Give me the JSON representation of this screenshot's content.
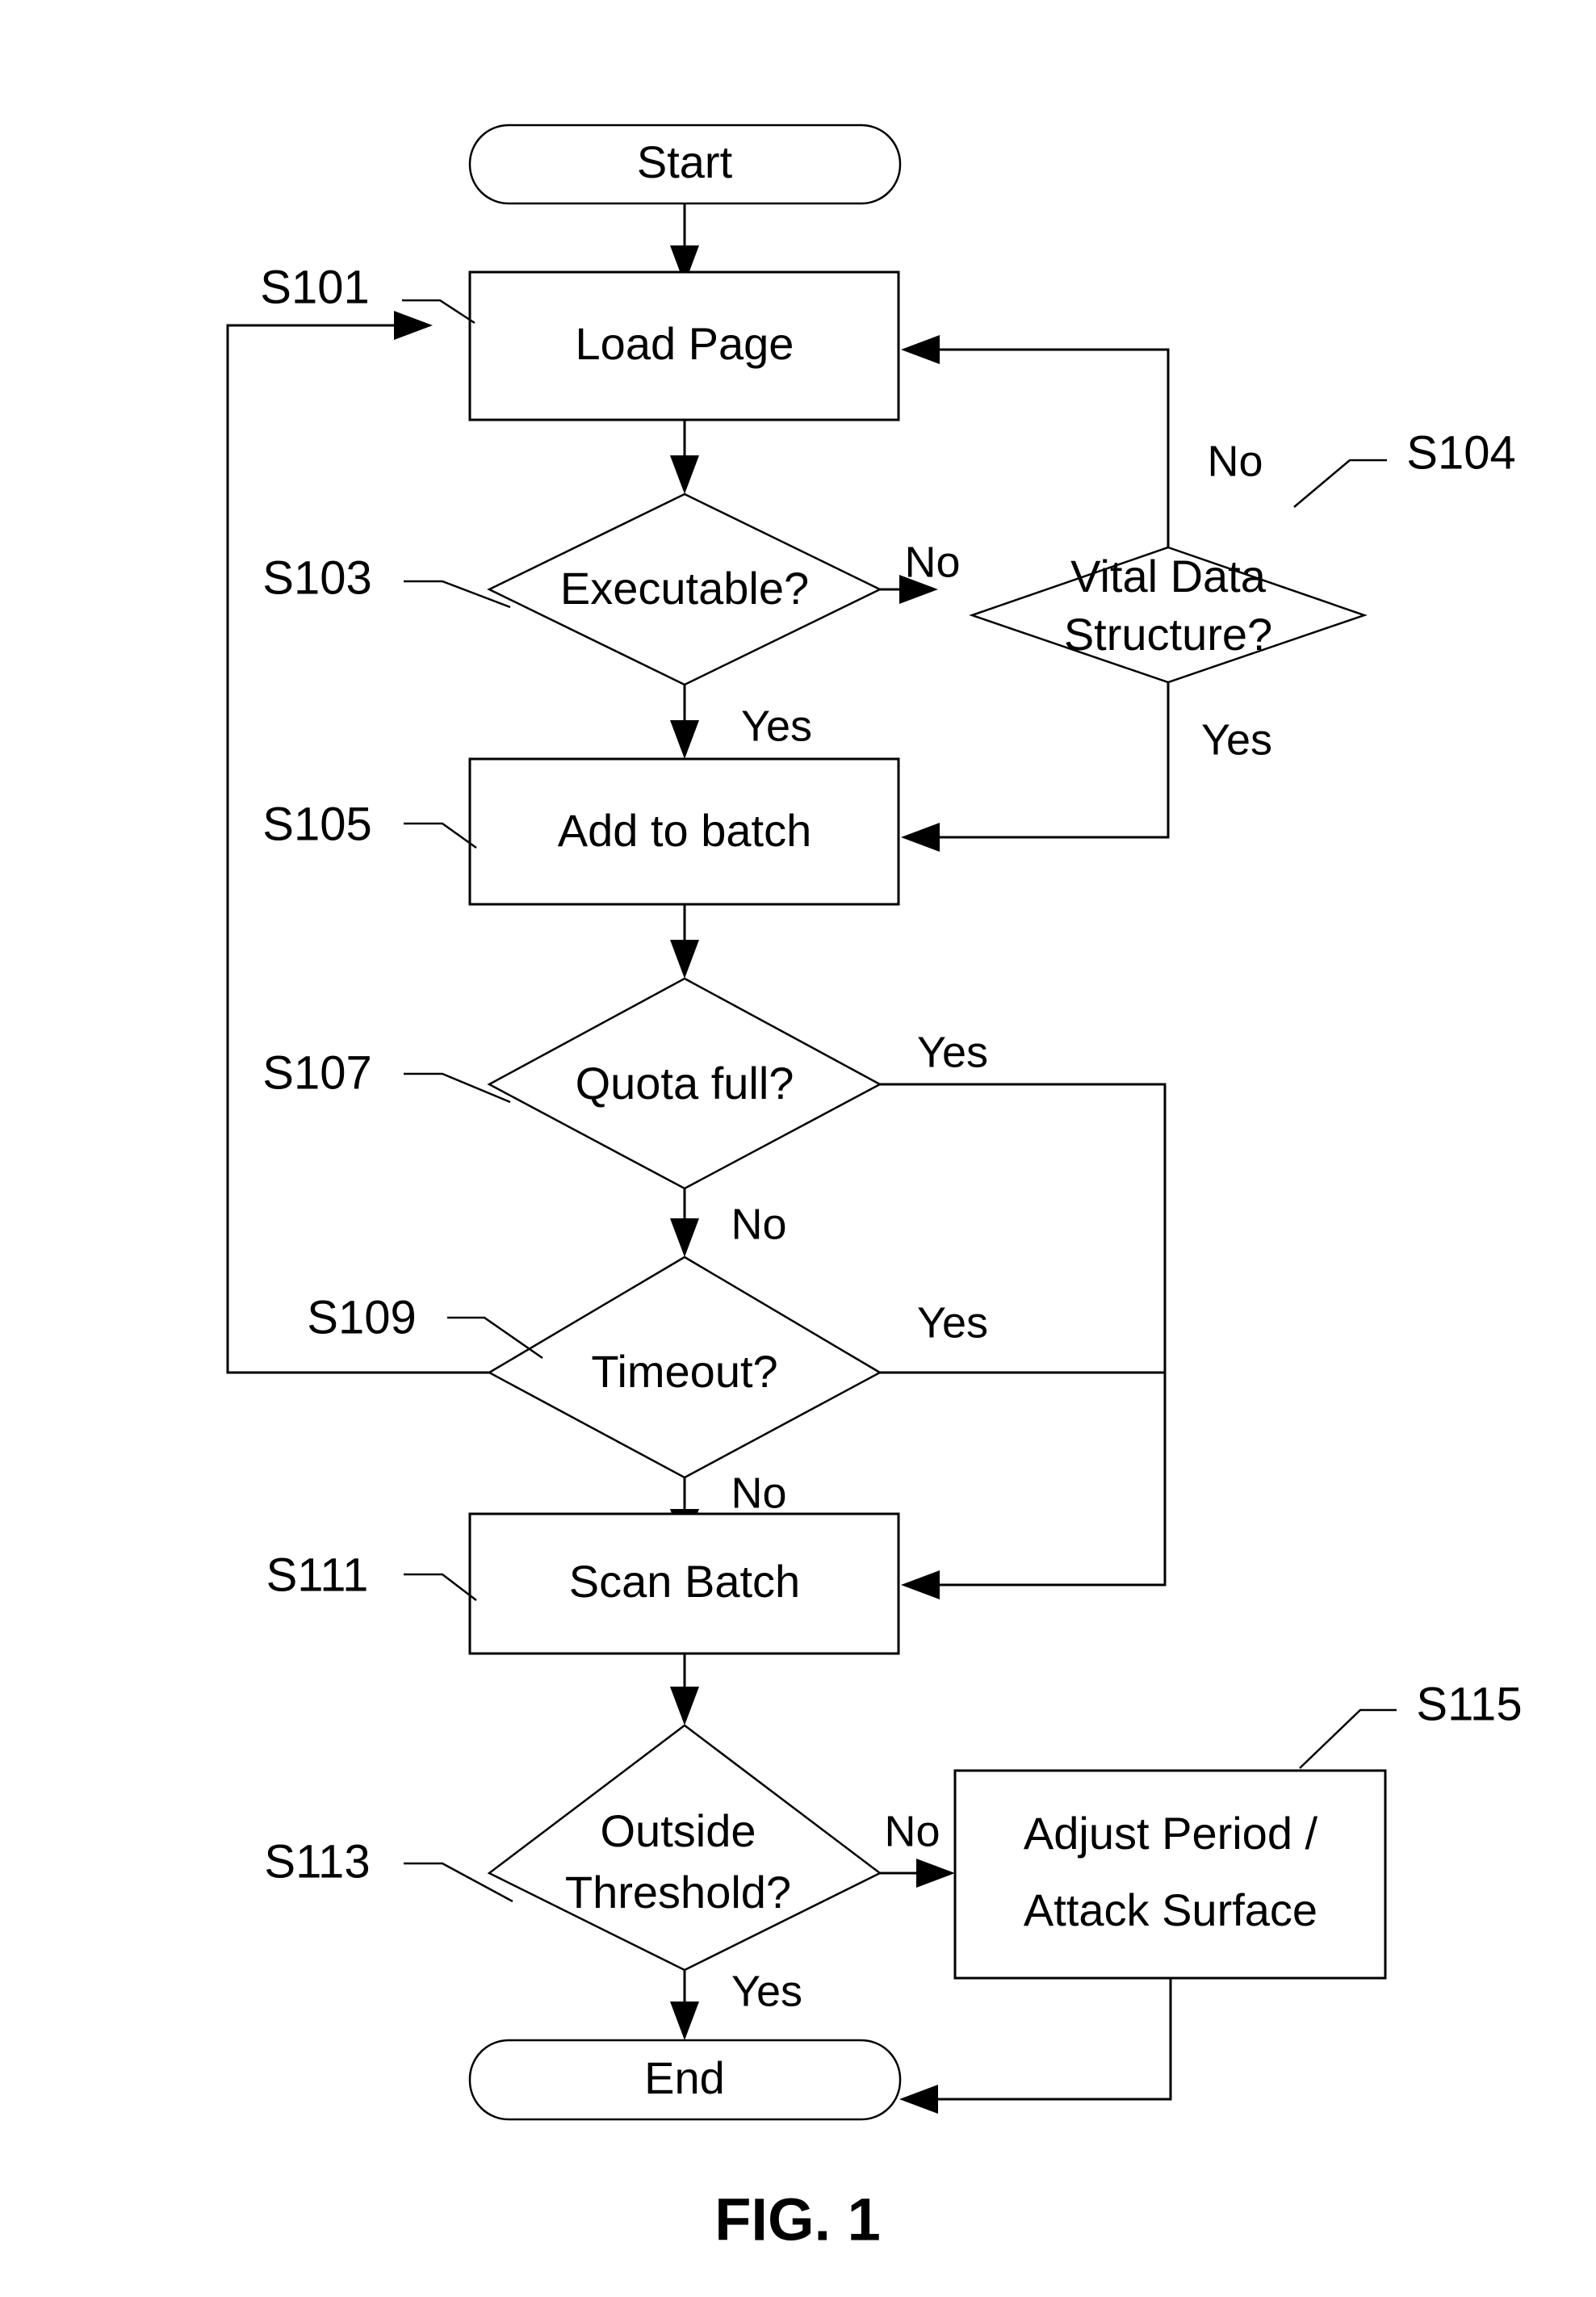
{
  "figure": {
    "caption": "FIG. 1",
    "type": "patent-flowchart"
  },
  "nodes": {
    "start": {
      "label": "Start",
      "shape": "terminator"
    },
    "load_page": {
      "label": "Load Page",
      "shape": "process",
      "step": "S101"
    },
    "executable": {
      "label": "Executable?",
      "shape": "decision",
      "step": "S103"
    },
    "vital_data_l1": {
      "label": "Vital Data",
      "label2": "Structure?",
      "shape": "decision",
      "step": "S104"
    },
    "add_to_batch": {
      "label": "Add to batch",
      "shape": "process",
      "step": "S105"
    },
    "quota_full": {
      "label": "Quota full?",
      "shape": "decision",
      "step": "S107"
    },
    "timeout": {
      "label": "Timeout?",
      "shape": "decision",
      "step": "S109"
    },
    "scan_batch": {
      "label": "Scan Batch",
      "shape": "process",
      "step": "S111"
    },
    "outside_threshold_l1": {
      "label": "Outside",
      "label2": "Threshold?",
      "shape": "decision",
      "step": "S113"
    },
    "adjust_period_l1": {
      "label": "Adjust Period /",
      "label2": "Attack Surface",
      "shape": "process",
      "step": "S115"
    },
    "end": {
      "label": "End",
      "shape": "terminator"
    }
  },
  "step_labels": {
    "s101": "S101",
    "s103": "S103",
    "s104": "S104",
    "s105": "S105",
    "s107": "S107",
    "s109": "S109",
    "s111": "S111",
    "s113": "S113",
    "s115": "S115"
  },
  "edge_labels": {
    "executable_no": "No",
    "executable_yes": "Yes",
    "vital_no": "No",
    "vital_yes": "Yes",
    "quota_yes": "Yes",
    "quota_no": "No",
    "timeout_yes": "Yes",
    "timeout_no": "No",
    "threshold_no": "No",
    "threshold_yes": "Yes"
  },
  "colors": {
    "stroke": "#000000",
    "fill": "#ffffff",
    "background": "#ffffff"
  },
  "chart_data": {
    "type": "flowchart",
    "title": "FIG. 1",
    "nodes": [
      {
        "id": "S_start",
        "label": "Start",
        "shape": "terminator"
      },
      {
        "id": "S101",
        "label": "Load Page",
        "shape": "process"
      },
      {
        "id": "S103",
        "label": "Executable?",
        "shape": "decision"
      },
      {
        "id": "S104",
        "label": "Vital Data Structure?",
        "shape": "decision"
      },
      {
        "id": "S105",
        "label": "Add to batch",
        "shape": "process"
      },
      {
        "id": "S107",
        "label": "Quota full?",
        "shape": "decision"
      },
      {
        "id": "S109",
        "label": "Timeout?",
        "shape": "decision"
      },
      {
        "id": "S111",
        "label": "Scan Batch",
        "shape": "process"
      },
      {
        "id": "S113",
        "label": "Outside Threshold?",
        "shape": "decision"
      },
      {
        "id": "S115",
        "label": "Adjust Period / Attack Surface",
        "shape": "process"
      },
      {
        "id": "S_end",
        "label": "End",
        "shape": "terminator"
      }
    ],
    "edges": [
      {
        "from": "S_start",
        "to": "S101",
        "label": ""
      },
      {
        "from": "S101",
        "to": "S103",
        "label": ""
      },
      {
        "from": "S103",
        "to": "S104",
        "label": "No"
      },
      {
        "from": "S103",
        "to": "S105",
        "label": "Yes"
      },
      {
        "from": "S104",
        "to": "S101",
        "label": "No"
      },
      {
        "from": "S104",
        "to": "S105",
        "label": "Yes"
      },
      {
        "from": "S105",
        "to": "S107",
        "label": ""
      },
      {
        "from": "S107",
        "to": "S111",
        "label": "Yes"
      },
      {
        "from": "S107",
        "to": "S109",
        "label": "No"
      },
      {
        "from": "S109",
        "to": "S111",
        "label": "Yes"
      },
      {
        "from": "S109",
        "to": "S101",
        "label": ""
      },
      {
        "from": "S109",
        "to": "S111",
        "label": "No"
      },
      {
        "from": "S111",
        "to": "S113",
        "label": ""
      },
      {
        "from": "S113",
        "to": "S115",
        "label": "No"
      },
      {
        "from": "S113",
        "to": "S_end",
        "label": "Yes"
      },
      {
        "from": "S115",
        "to": "S_end",
        "label": ""
      }
    ]
  }
}
